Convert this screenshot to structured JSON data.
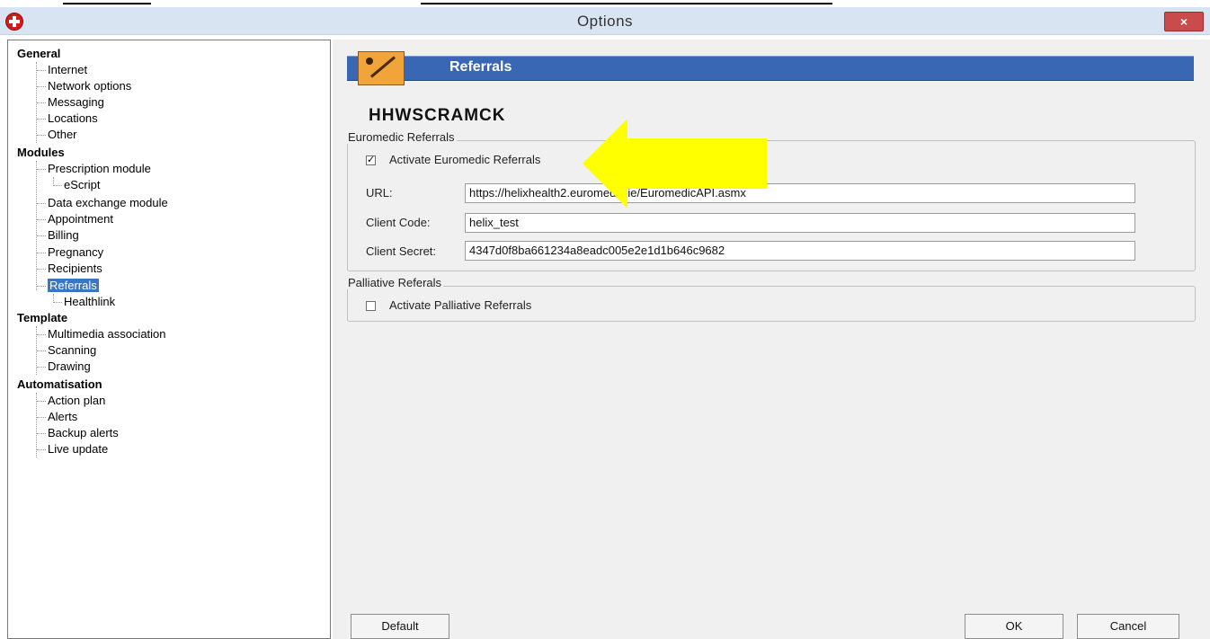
{
  "window": {
    "title": "Options",
    "close_label": "×"
  },
  "tree": {
    "categories": [
      {
        "label": "General",
        "children": [
          "Internet",
          "Network options",
          "Messaging",
          "Locations",
          "Other"
        ]
      },
      {
        "label": "Modules",
        "children": [
          "Prescription module",
          "eScript",
          "Data exchange module",
          "Appointment",
          "Billing",
          "Pregnancy",
          "Recipients",
          "Referrals",
          "Healthlink"
        ]
      },
      {
        "label": "Template",
        "children": [
          "Multimedia association",
          "Scanning",
          "Drawing"
        ]
      },
      {
        "label": "Automatisation",
        "children": [
          "Action plan",
          "Alerts",
          "Backup alerts",
          "Live update"
        ]
      }
    ],
    "selected": "Referrals"
  },
  "panel": {
    "header_title": "Referrals",
    "practice_code": "HHWSCRAMCK",
    "euromedic": {
      "legend": "Euromedic Referrals",
      "activate_label": "Activate Euromedic Referrals",
      "activate_checked": true,
      "url_label": "URL:",
      "url_value": "https://helixhealth2.euromedic.ie/EuromedicAPI.asmx",
      "client_code_label": "Client Code:",
      "client_code_value": "helix_test",
      "client_secret_label": "Client Secret:",
      "client_secret_value": "4347d0f8ba661234a8eadc005e2e1d1b646c9682"
    },
    "palliative": {
      "legend": "Palliative Referals",
      "activate_label": "Activate Palliative Referrals",
      "activate_checked": false
    }
  },
  "buttons": {
    "default": "Default",
    "ok": "OK",
    "cancel": "Cancel"
  },
  "colors": {
    "header_blue": "#3a67b3",
    "selection_blue": "#3b76c5",
    "arrow_yellow": "#ffff00",
    "close_red": "#c94b4b"
  }
}
